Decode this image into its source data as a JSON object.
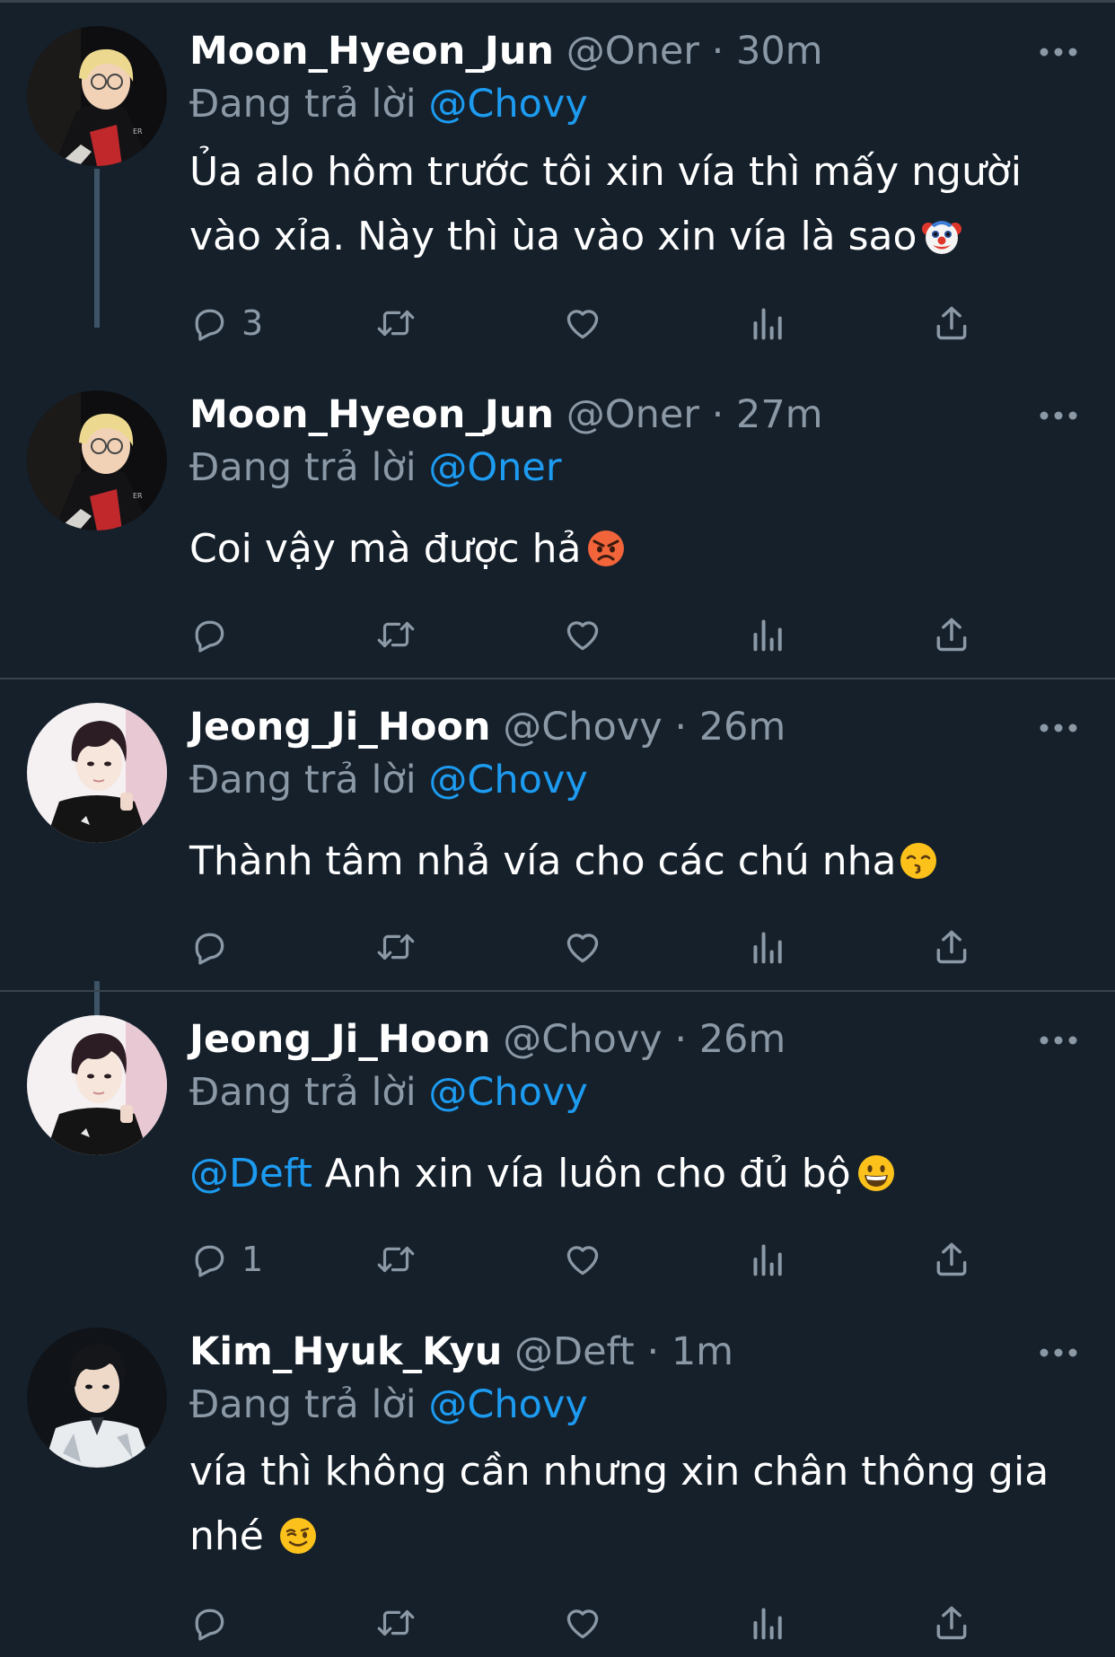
{
  "tweets": [
    {
      "display_name": "Moon_Hyeon_Jun",
      "handle": "@Oner",
      "time": "30m",
      "replying_prefix": "Đang trả lời",
      "replying_to": "@Chovy",
      "text_lines": [
        "Ủa alo hôm trước tôi xin vía thì mấy người",
        "vào xỉa. Này thì ùa vào xin vía là sao"
      ],
      "emoji": "clown-face",
      "reply_count": "3"
    },
    {
      "display_name": "Moon_Hyeon_Jun",
      "handle": "@Oner",
      "time": "27m",
      "replying_prefix": "Đang trả lời",
      "replying_to": "@Oner",
      "text_lines": [
        "Coi vậy mà được hả"
      ],
      "emoji": "angry-face",
      "reply_count": ""
    },
    {
      "display_name": "Jeong_Ji_Hoon",
      "handle": "@Chovy",
      "time": "26m",
      "replying_prefix": "Đang trả lời",
      "replying_to": "@Chovy",
      "text_lines": [
        "Thành tâm nhả vía cho các chú nha"
      ],
      "emoji": "kissing-face",
      "reply_count": ""
    },
    {
      "display_name": "Jeong_Ji_Hoon",
      "handle": "@Chovy",
      "time": "26m",
      "replying_prefix": "Đang trả lời",
      "replying_to": "@Chovy",
      "text_mention": "@Deft",
      "text_lines": [
        " Anh xin vía luôn cho đủ bộ"
      ],
      "emoji": "grinning-face",
      "reply_count": "1"
    },
    {
      "display_name": "Kim_Hyuk_Kyu",
      "handle": "@Deft",
      "time": "1m",
      "replying_prefix": "Đang trả lời",
      "replying_to": "@Chovy",
      "text_lines": [
        "vía thì không cần nhưng xin chân thông gia",
        "nhé"
      ],
      "emoji": "winking-face",
      "reply_count": ""
    }
  ],
  "separator": "·",
  "colors": {
    "background": "#15202b",
    "text": "#ffffff",
    "secondary": "#8b98a5",
    "link": "#1d9bf0",
    "divider": "#38444d"
  }
}
